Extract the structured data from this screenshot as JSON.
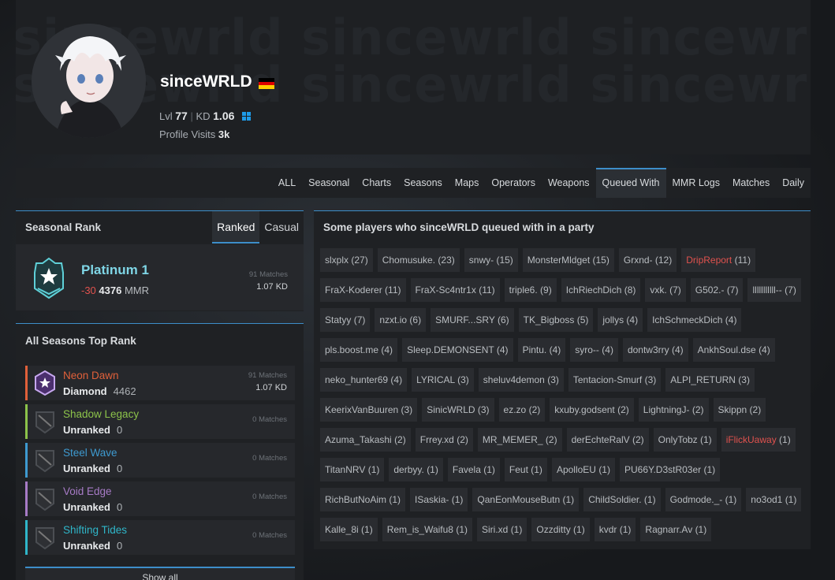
{
  "header": {
    "watermark": "sincewrld sincewrld sincewrld sincewrld",
    "watermark2": "sincewrld sincewrld sincewrld sincewrld",
    "username": "sinceWRLD",
    "level_label": "Lvl",
    "level": "77",
    "kd_label": "KD",
    "kd": "1.06",
    "visits_label": "Profile Visits",
    "visits": "3k",
    "flag_colors": [
      "#000000",
      "#dd0000",
      "#ffce00"
    ],
    "platform_icon": "windows-icon"
  },
  "tabs": [
    "ALL",
    "Seasonal",
    "Charts",
    "Seasons",
    "Maps",
    "Operators",
    "Weapons",
    "Queued With",
    "MMR Logs",
    "Matches",
    "Daily"
  ],
  "active_tab": "Queued With",
  "seasonal_rank": {
    "title": "Seasonal Rank",
    "tab_ranked": "Ranked",
    "tab_casual": "Casual",
    "rank": "Platinum 1",
    "delta": "-30",
    "mmr": "4376",
    "mmr_label": "MMR",
    "matches": "91 Matches",
    "kd": "1.07 KD"
  },
  "all_seasons": {
    "title": "All Seasons Top Rank",
    "rows": [
      {
        "season": "Neon Dawn",
        "rank": "Diamond",
        "mmr": "4462",
        "matches": "91 Matches",
        "kd": "1.07 KD",
        "color": "#e0603a"
      },
      {
        "season": "Shadow Legacy",
        "rank": "Unranked",
        "mmr": "0",
        "matches": "0 Matches",
        "kd": "",
        "color": "#8cc34a"
      },
      {
        "season": "Steel Wave",
        "rank": "Unranked",
        "mmr": "0",
        "matches": "0 Matches",
        "kd": "",
        "color": "#3e9ad0"
      },
      {
        "season": "Void Edge",
        "rank": "Unranked",
        "mmr": "0",
        "matches": "0 Matches",
        "kd": "",
        "color": "#a77bc6"
      },
      {
        "season": "Shifting Tides",
        "rank": "Unranked",
        "mmr": "0",
        "matches": "0 Matches",
        "kd": "",
        "color": "#2fb6c9"
      }
    ],
    "show_all": "Show all"
  },
  "queued": {
    "title": "Some players who sinceWRLD queued with in a party",
    "players": [
      {
        "name": "slxplx",
        "count": "(27)"
      },
      {
        "name": "Chomusuke.",
        "count": "(23)"
      },
      {
        "name": "snwy-",
        "count": "(15)"
      },
      {
        "name": "MonsterMldget",
        "count": "(15)"
      },
      {
        "name": "Grxnd-",
        "count": "(12)"
      },
      {
        "name": "DripReport",
        "count": "(11)",
        "red": true
      },
      {
        "name": "FraX-Koderer",
        "count": "(11)"
      },
      {
        "name": "FraX-Sc4ntr1x",
        "count": "(11)"
      },
      {
        "name": "triple6.",
        "count": "(9)"
      },
      {
        "name": "IchRiechDich",
        "count": "(8)"
      },
      {
        "name": "vxk.",
        "count": "(7)"
      },
      {
        "name": "G502.-",
        "count": "(7)"
      },
      {
        "name": "lllllllllll--",
        "count": "(7)"
      },
      {
        "name": "Statyy",
        "count": "(7)"
      },
      {
        "name": "nzxt.io",
        "count": "(6)"
      },
      {
        "name": "SMURF...SRY",
        "count": "(6)"
      },
      {
        "name": "TK_Bigboss",
        "count": "(5)"
      },
      {
        "name": "jollys",
        "count": "(4)"
      },
      {
        "name": "IchSchmeckDich",
        "count": "(4)"
      },
      {
        "name": "pls.boost.me",
        "count": "(4)"
      },
      {
        "name": "Sleep.DEMONSENT",
        "count": "(4)"
      },
      {
        "name": "Pintu.",
        "count": "(4)"
      },
      {
        "name": "syro--",
        "count": "(4)"
      },
      {
        "name": "dontw3rry",
        "count": "(4)"
      },
      {
        "name": "AnkhSoul.dse",
        "count": "(4)"
      },
      {
        "name": "neko_hunter69",
        "count": "(4)"
      },
      {
        "name": "LYRICAL",
        "count": "(3)"
      },
      {
        "name": "sheluv4demon",
        "count": "(3)"
      },
      {
        "name": "Tentacion-Smurf",
        "count": "(3)"
      },
      {
        "name": "ALPI_RETURN",
        "count": "(3)"
      },
      {
        "name": "KeerixVanBuuren",
        "count": "(3)"
      },
      {
        "name": "SinicWRLD",
        "count": "(3)"
      },
      {
        "name": "ez.zo",
        "count": "(2)"
      },
      {
        "name": "kxuby.godsent",
        "count": "(2)"
      },
      {
        "name": "LightningJ-",
        "count": "(2)"
      },
      {
        "name": "Skippn",
        "count": "(2)"
      },
      {
        "name": "Azuma_Takashi",
        "count": "(2)"
      },
      {
        "name": "Frrey.xd",
        "count": "(2)"
      },
      {
        "name": "MR_MEMER_",
        "count": "(2)"
      },
      {
        "name": "derEchteRalV",
        "count": "(2)"
      },
      {
        "name": "OnlyTobz",
        "count": "(1)"
      },
      {
        "name": "iFlickUaway",
        "count": "(1)",
        "red": true
      },
      {
        "name": "TitanNRV",
        "count": "(1)"
      },
      {
        "name": "derbyy.",
        "count": "(1)"
      },
      {
        "name": "Favela",
        "count": "(1)"
      },
      {
        "name": "Feut",
        "count": "(1)"
      },
      {
        "name": "ApolloEU",
        "count": "(1)"
      },
      {
        "name": "PU66Y.D3stR03er",
        "count": "(1)"
      },
      {
        "name": "RichButNoAim",
        "count": "(1)"
      },
      {
        "name": "ISaskia-",
        "count": "(1)"
      },
      {
        "name": "QanEonMouseButn",
        "count": "(1)"
      },
      {
        "name": "ChildSoldier.",
        "count": "(1)"
      },
      {
        "name": "Godmode._-",
        "count": "(1)"
      },
      {
        "name": "no3od1",
        "count": "(1)"
      },
      {
        "name": "Kalle_8i",
        "count": "(1)"
      },
      {
        "name": "Rem_is_Waifu8",
        "count": "(1)"
      },
      {
        "name": "Siri.xd",
        "count": "(1)"
      },
      {
        "name": "Ozzditty",
        "count": "(1)"
      },
      {
        "name": "kvdr",
        "count": "(1)"
      },
      {
        "name": "Ragnarr.Av",
        "count": "(1)"
      }
    ]
  }
}
